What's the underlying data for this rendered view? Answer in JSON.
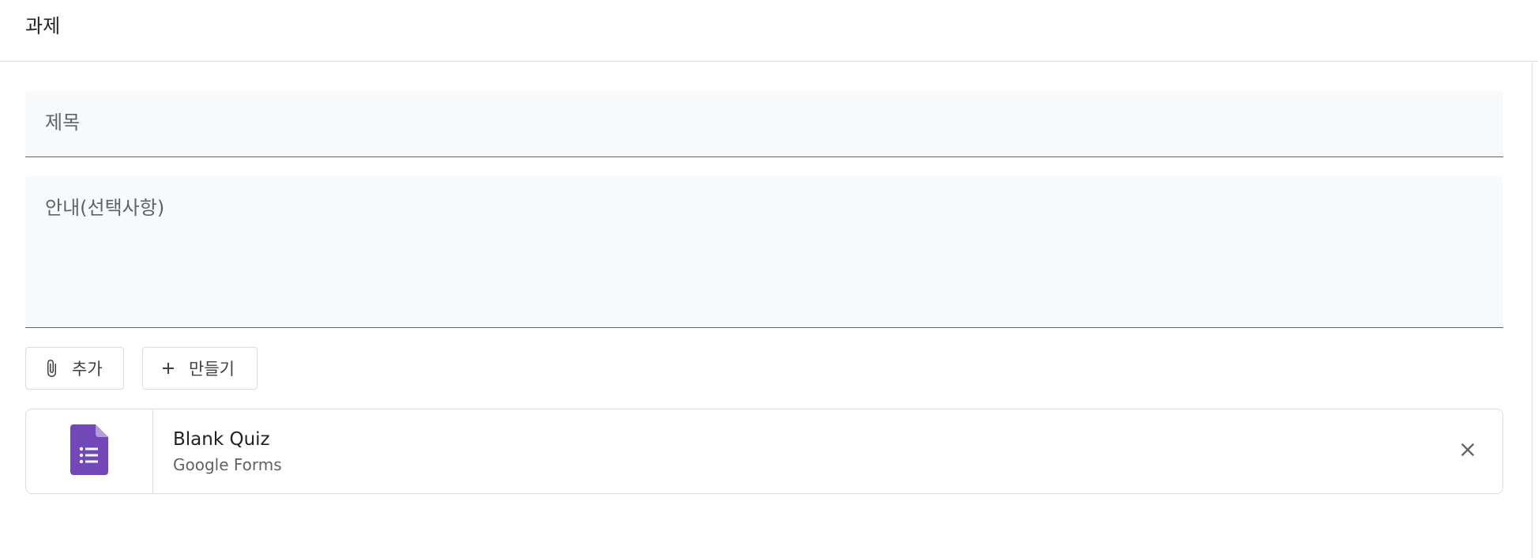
{
  "header": {
    "title": "과제"
  },
  "form": {
    "title_placeholder": "제목",
    "description_placeholder": "안내(선택사항)"
  },
  "actions": {
    "add_label": "추가",
    "create_label": "만들기",
    "add_icon": "paperclip-icon",
    "create_icon": "plus-icon"
  },
  "attachment": {
    "title": "Blank Quiz",
    "subtitle": "Google Forms",
    "icon": "google-forms-icon",
    "remove_icon": "close-icon",
    "icon_color": "#7248b9"
  }
}
